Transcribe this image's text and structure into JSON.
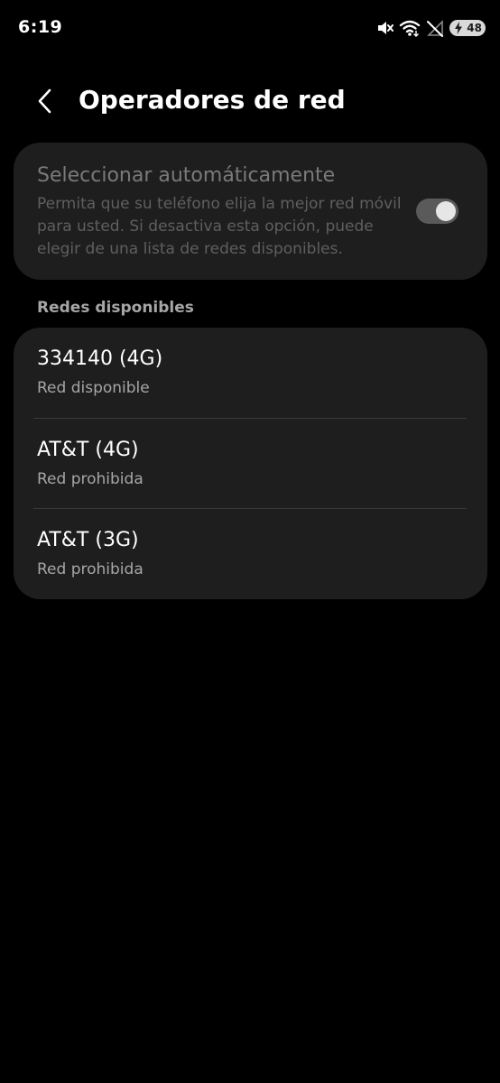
{
  "status_bar": {
    "time": "6:19",
    "icons": [
      "mute-icon",
      "wifi-icon",
      "no-signal-icon",
      "battery-icon"
    ],
    "battery_level": "48"
  },
  "header": {
    "back_icon": "chevron-left-icon",
    "title": "Operadores de red"
  },
  "auto_select": {
    "title": "Seleccionar automáticamente",
    "description": "Permita que su teléfono elija la mejor red móvil para usted. Si desactiva esta opción, puede elegir de una lista de redes disponibles.",
    "toggle_on": true,
    "enabled": false
  },
  "available_networks": {
    "section_label": "Redes disponibles",
    "items": [
      {
        "name": "334140 (4G)",
        "status": "Red disponible"
      },
      {
        "name": "AT&T (4G)",
        "status": "Red prohibida"
      },
      {
        "name": "AT&T (3G)",
        "status": "Red prohibida"
      }
    ]
  },
  "colors": {
    "background": "#000000",
    "card": "#1e1e1e",
    "text_primary": "#ffffff",
    "text_secondary": "#a6a6a6",
    "text_disabled": "#7a7a7a"
  }
}
